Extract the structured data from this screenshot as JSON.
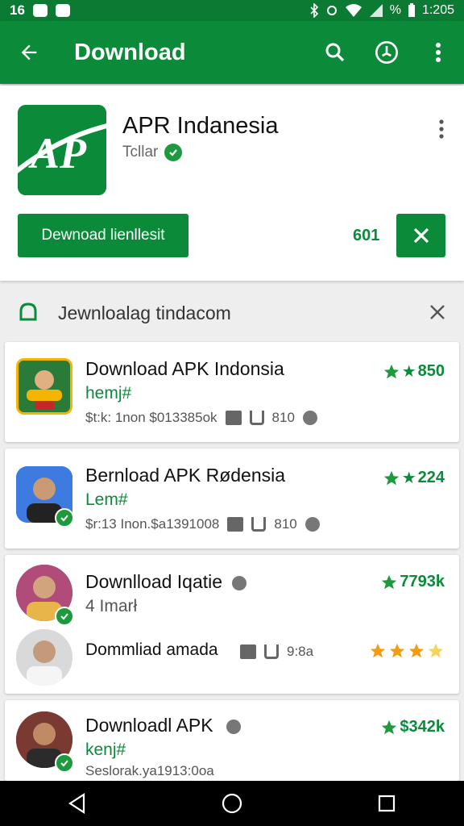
{
  "status_bar": {
    "time_left": "16",
    "time": "1:205",
    "battery_text": "%"
  },
  "appbar": {
    "title": "Download"
  },
  "app": {
    "name": "APR Indanesia",
    "developer": "Tcllar",
    "download_label": "Dewnoad lienllesit",
    "count": "601",
    "icon_text": "AP"
  },
  "notice": {
    "text": "Jewnloalag tindacom"
  },
  "items": [
    {
      "title": "Download APK Indonsia",
      "subtitle": "hemj#",
      "meta": "$t:k: 1non $013385ok",
      "meta_num": "810",
      "rating": "850"
    },
    {
      "title": "Bernload APK Rødensia",
      "subtitle": "Lem#",
      "meta": "$r:13 Inon.$a1391008",
      "meta_num": "810",
      "rating": "224"
    },
    {
      "title": "Downlload Iqatie",
      "subtitle": "4 Imarł",
      "rating": "7793k"
    },
    {
      "title": "Dommliad amada",
      "meta_num": "9:8a",
      "stars": 3.5
    },
    {
      "title": "Downloadl APK",
      "subtitle": "kenj#",
      "meta": "Seslorak.ya1913:0oa",
      "rating": "$342k"
    }
  ],
  "colors": {
    "primary": "#0b8a3a",
    "status": "#0b7a32",
    "star_orange": "#f39c12"
  }
}
